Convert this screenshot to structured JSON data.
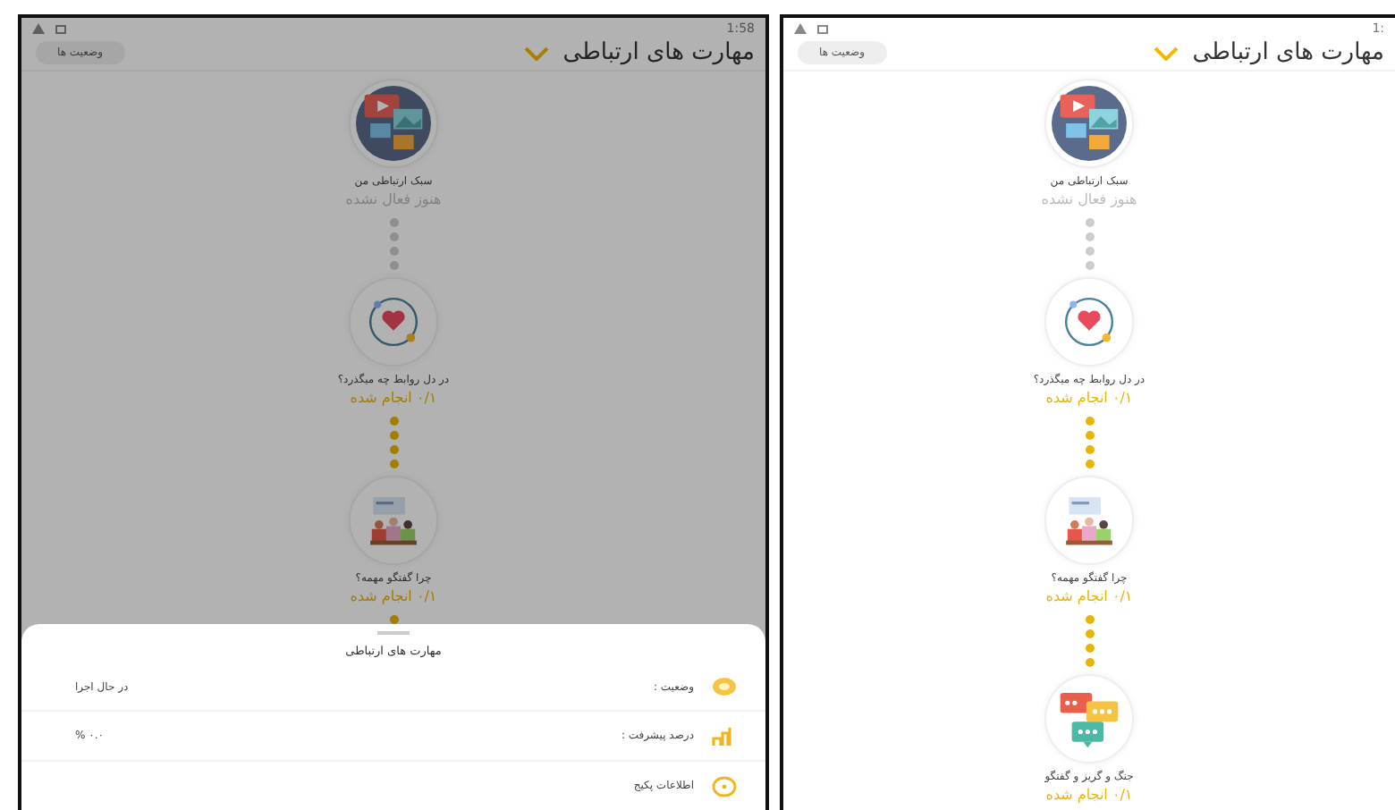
{
  "screens": [
    {
      "status_time": "1:",
      "title": "مهارت های ارتباطی",
      "status_button": "وضعیت ها",
      "continues": false,
      "steps": [
        {
          "kind": "video",
          "title": "سبک ارتباطی من",
          "status": "هنوز فعال نشده",
          "locked": true
        },
        {
          "kind": "heart",
          "title": "در دل روابط چه میگذرد؟",
          "status": "۰/۱ انجام شده",
          "locked": false
        },
        {
          "kind": "meeting",
          "title": "چرا گفتگو مهمه؟",
          "status": "۰/۱ انجام شده",
          "locked": false
        },
        {
          "kind": "chat",
          "title": "جنگ و گریز و گفتگو",
          "status": "۰/۱ انجام شده",
          "locked": false
        }
      ]
    },
    {
      "status_time": "1:58",
      "title": "مهارت های ارتباطی",
      "status_button": "وضعیت ها",
      "continues": true,
      "steps": [
        {
          "kind": "video",
          "title": "سبک ارتباطی من",
          "status": "هنوز فعال نشده",
          "locked": true
        },
        {
          "kind": "heart",
          "title": "در دل روابط چه میگذرد؟",
          "status": "۰/۱ انجام شده",
          "locked": false
        },
        {
          "kind": "meeting",
          "title": "چرا گفتگو مهمه؟",
          "status": "۰/۱ انجام شده",
          "locked": false
        }
      ],
      "sheet": {
        "title": "مهارت های ارتباطی",
        "rows": [
          {
            "kind": "status",
            "label": "وضعیت :",
            "value": "در حال اجرا"
          },
          {
            "kind": "progress",
            "label": "درصد پیشرفت :",
            "value": "۰.۰ %"
          },
          {
            "kind": "info",
            "label": "اطلاعات پکیج"
          }
        ]
      }
    }
  ]
}
